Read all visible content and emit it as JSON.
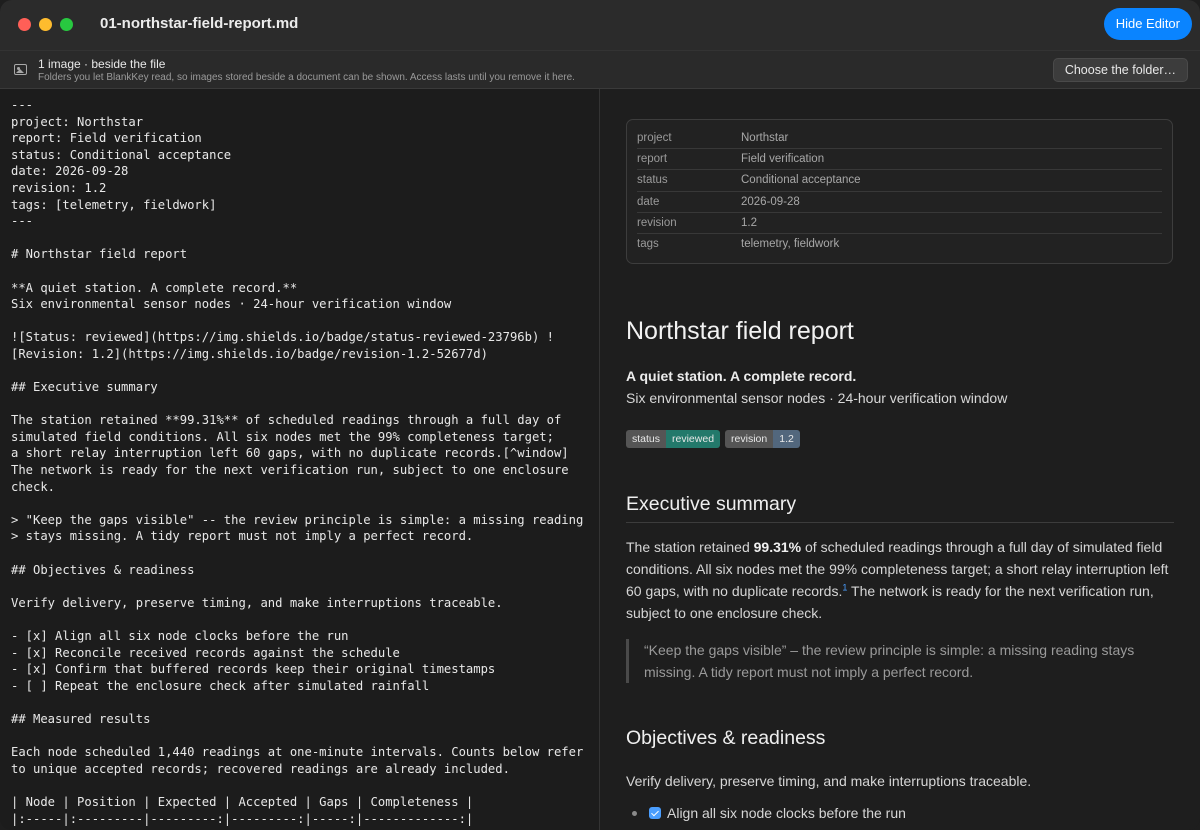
{
  "window": {
    "title": "01-northstar-field-report.md",
    "hide_editor_label": "Hide Editor"
  },
  "infobar": {
    "icon": "image-icon",
    "title": "1 image · beside the file",
    "subtitle": "Folders you let BlankKey read, so images stored beside a document can be shown. Access lasts until you remove it here.",
    "choose_label": "Choose the folder…"
  },
  "editor": {
    "source": "---\nproject: Northstar\nreport: Field verification\nstatus: Conditional acceptance\ndate: 2026-09-28\nrevision: 1.2\ntags: [telemetry, fieldwork]\n---\n\n# Northstar field report\n\n**A quiet station. A complete record.**\nSix environmental sensor nodes · 24-hour verification window\n\n![Status: reviewed](https://img.shields.io/badge/status-reviewed-23796b) !\n[Revision: 1.2](https://img.shields.io/badge/revision-1.2-52677d)\n\n## Executive summary\n\nThe station retained **99.31%** of scheduled readings through a full day of\nsimulated field conditions. All six nodes met the 99% completeness target;\na short relay interruption left 60 gaps, with no duplicate records.[^window]\nThe network is ready for the next verification run, subject to one enclosure\ncheck.\n\n> \"Keep the gaps visible\" -- the review principle is simple: a missing reading\n> stays missing. A tidy report must not imply a perfect record.\n\n## Objectives & readiness\n\nVerify delivery, preserve timing, and make interruptions traceable.\n\n- [x] Align all six node clocks before the run\n- [x] Reconcile received records against the schedule\n- [x] Confirm that buffered records keep their original timestamps\n- [ ] Repeat the enclosure check after simulated rainfall\n\n## Measured results\n\nEach node scheduled 1,440 readings at one-minute intervals. Counts below refer\nto unique accepted records; recovered readings are already included.\n\n| Node | Position | Expected | Accepted | Gaps | Completeness |\n|:-----|:---------|---------:|---------:|-----:|-------------:|"
  },
  "preview": {
    "frontmatter": [
      {
        "key": "project",
        "value": "Northstar"
      },
      {
        "key": "report",
        "value": "Field verification"
      },
      {
        "key": "status",
        "value": "Conditional acceptance"
      },
      {
        "key": "date",
        "value": "2026-09-28"
      },
      {
        "key": "revision",
        "value": "1.2"
      },
      {
        "key": "tags",
        "value": "telemetry, fieldwork"
      }
    ],
    "h1": "Northstar field report",
    "lead": "A quiet station. A complete record.",
    "sublead": "Six environmental sensor nodes · 24-hour verification window",
    "badges": [
      {
        "label": "status",
        "value": "reviewed",
        "color": "#23796b"
      },
      {
        "label": "revision",
        "value": "1.2",
        "color": "#52677d"
      }
    ],
    "exec_heading": "Executive summary",
    "exec_p1": "The station retained ",
    "exec_bold": "99.31%",
    "exec_p2": " of scheduled readings through a full day of simulated field conditions. All six nodes met the 99% completeness target; a short relay interruption left 60 gaps, with no duplicate records.",
    "exec_fn": "1",
    "exec_p3": " The network is ready for the next verification run, subject to one enclosure check.",
    "quote": "“Keep the gaps visible” – the review principle is simple: a missing reading stays missing. A tidy report must not imply a perfect record.",
    "obj_heading": "Objectives & readiness",
    "obj_para": "Verify delivery, preserve timing, and make interruptions traceable.",
    "task1": "Align all six node clocks before the run"
  }
}
